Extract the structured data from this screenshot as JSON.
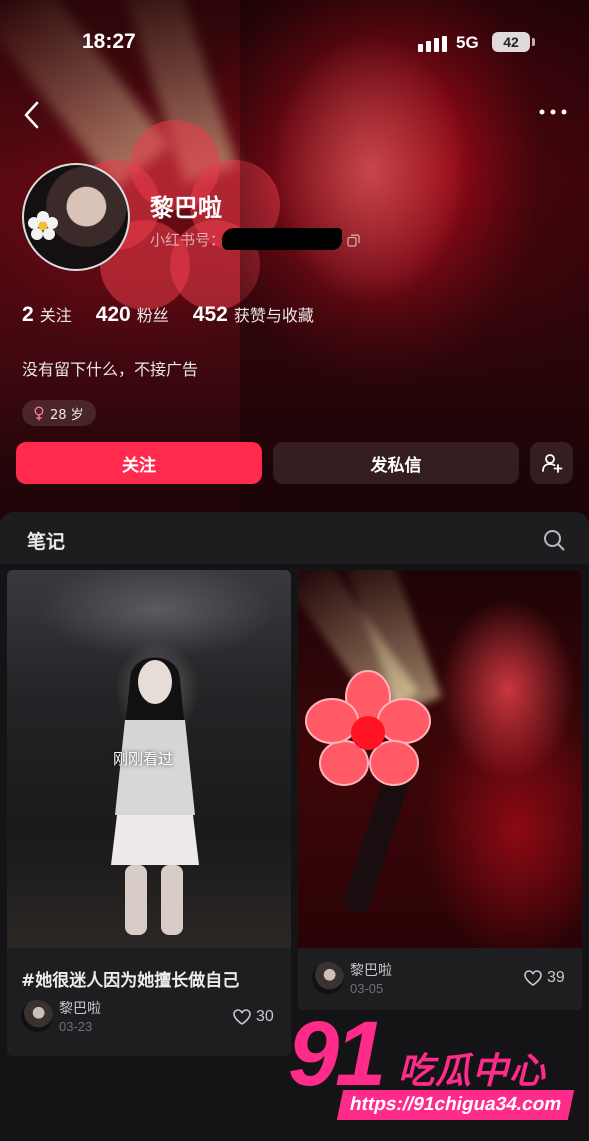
{
  "status_bar": {
    "time": "18:27",
    "network": "5G",
    "battery": "42"
  },
  "profile": {
    "name": "黎巴啦",
    "id_label": "小红书号：",
    "stats": [
      {
        "num": "2",
        "label": "关注"
      },
      {
        "num": "420",
        "label": "粉丝"
      },
      {
        "num": "452",
        "label": "获赞与收藏"
      }
    ],
    "bio": "没有留下什么，不接广告",
    "tag": "28 岁",
    "follow_label": "关注",
    "message_label": "发私信"
  },
  "notes": {
    "title": "笔记",
    "cards": [
      {
        "seen_label": "刚刚看过",
        "title": "#她很迷人因为她擅长做自己",
        "author": "黎巴啦",
        "date": "03-23",
        "likes": "30"
      },
      {
        "author": "黎巴啦",
        "date": "03-05",
        "likes": "39"
      }
    ]
  },
  "watermark": {
    "brand_num": "91",
    "brand_text": "吃瓜中心",
    "url": "https://91chigua34.com"
  },
  "colors": {
    "accent": "#ff2a4d",
    "watermark": "#ff2b8a",
    "background": "#141416"
  },
  "icons": [
    "back-icon",
    "more-icon",
    "copy-icon",
    "female-icon",
    "add-friend-icon",
    "search-icon",
    "heart-icon"
  ]
}
